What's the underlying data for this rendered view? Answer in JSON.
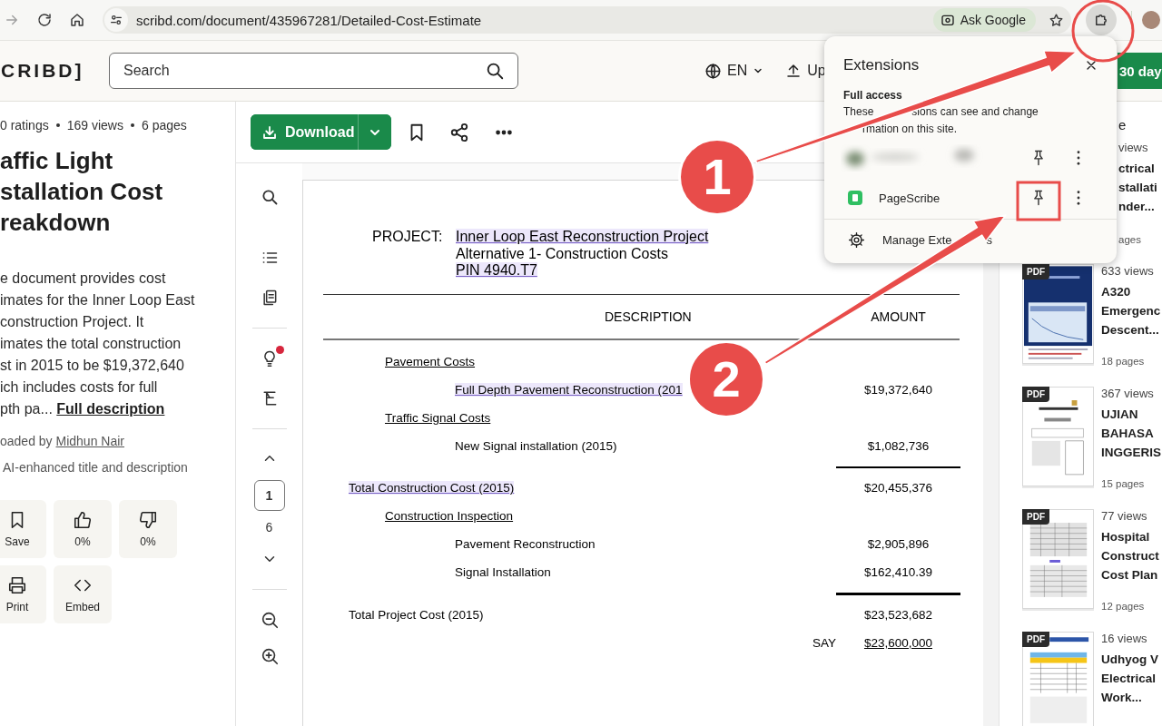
{
  "browser": {
    "url": "scribd.com/document/435967281/Detailed-Cost-Estimate",
    "ask_button": "Ask Google"
  },
  "header": {
    "logo": "CRIBD]",
    "search": {
      "placeholder": "Search"
    },
    "language": "EN",
    "upload": "Up",
    "trial_button": "30 day"
  },
  "document_info": {
    "meta": [
      "0 ratings",
      "169 views",
      "6 pages"
    ],
    "title_lines": [
      "affic Light",
      "stallation Cost",
      "reakdown"
    ],
    "description_lines": [
      "e document provides cost",
      "imates for the Inner Loop East",
      "construction Project. It",
      "imates the total construction",
      "st in 2015 to be $19,372,640",
      "ich includes costs for full"
    ],
    "description_tail": "pth pa... ",
    "full_description_link": "Full description",
    "uploader_prefix": "oaded by ",
    "uploader": "Midhun Nair",
    "ai_note": "AI-enhanced title and description",
    "actions": [
      {
        "kind": "save",
        "label": "Save"
      },
      {
        "kind": "like",
        "label": "0%"
      },
      {
        "kind": "dislike",
        "label": "0%"
      },
      {
        "kind": "print",
        "label": "Print"
      },
      {
        "kind": "embed",
        "label": "Embed"
      }
    ]
  },
  "toolbar": {
    "download": "Download"
  },
  "rail": {
    "insights_notification": true,
    "page": "1",
    "page_count": "6"
  },
  "document": {
    "project_label": "PROJECT:",
    "project_lines": [
      {
        "text": "Inner Loop East Reconstruction Project",
        "highlighted": true
      },
      {
        "text": "Alternative 1- Construction Costs",
        "highlighted": false
      },
      {
        "text": "PIN 4940.T7",
        "highlighted": true
      }
    ],
    "columns": [
      "DESCRIPTION",
      "AMOUNT"
    ],
    "rows": [
      {
        "kind": "section",
        "label": "Pavement Costs",
        "highlighted": false
      },
      {
        "kind": "item",
        "label": "Full Depth Pavement Reconstruction (201",
        "amount": "$19,372,640",
        "highlighted": true
      },
      {
        "kind": "section",
        "label": "Traffic Signal Costs",
        "highlighted": false
      },
      {
        "kind": "item",
        "label": "New Signal installation (2015)",
        "amount": "$1,082,736",
        "highlighted": false
      },
      {
        "kind": "rule"
      },
      {
        "kind": "total",
        "label": "Total Construction Cost (2015)",
        "amount": "$20,455,376",
        "highlighted": true
      },
      {
        "kind": "section",
        "label": "Construction Inspection",
        "highlighted": false
      },
      {
        "kind": "item",
        "label": "Pavement Reconstruction",
        "amount": "$2,905,896",
        "highlighted": false
      },
      {
        "kind": "item",
        "label": "Signal Installation",
        "amount": "$162,410.39",
        "highlighted": false
      },
      {
        "kind": "heavy_rule"
      },
      {
        "kind": "total",
        "label": "Total Project Cost (2015)",
        "amount": "$23,523,682",
        "highlighted": false
      },
      {
        "kind": "say",
        "label": "SAY",
        "amount": "$23,600,000"
      }
    ]
  },
  "related": {
    "heading": "e",
    "partial": {
      "views": "views",
      "title_lines": [
        "ctrical",
        "stallati",
        "nder..."
      ],
      "pages": "ages"
    },
    "items": [
      {
        "badge": "PDF",
        "views": "633 views",
        "title_lines": [
          "A320",
          "Emergenc",
          "Descent..."
        ],
        "pages": "18 pages"
      },
      {
        "badge": "PDF",
        "views": "367 views",
        "title_lines": [
          "UJIAN",
          "BAHASA",
          "INGGERIS"
        ],
        "pages": "15 pages"
      },
      {
        "badge": "PDF",
        "views": "77 views",
        "title_lines": [
          "Hospital",
          "Construct",
          "Cost Plan"
        ],
        "pages": "12 pages"
      },
      {
        "badge": "PDF",
        "views": "16 views",
        "title_lines": [
          "Udhyog V",
          "Electrical",
          "Work..."
        ]
      }
    ]
  },
  "extensions_popup": {
    "title": "Extensions",
    "section": "Full access",
    "description_pieces": [
      "These",
      "sions can see and change",
      "rmation on this site."
    ],
    "extensions": [
      {
        "kind": "blurred"
      },
      {
        "kind": "named",
        "name": "PageScribe"
      }
    ],
    "manage": [
      "Manage Exte",
      "s"
    ]
  },
  "annotations": [
    {
      "kind": "ring"
    },
    {
      "kind": "box"
    },
    {
      "kind": "arrow"
    },
    {
      "kind": "arrow"
    },
    {
      "kind": "callout",
      "label": "1"
    },
    {
      "kind": "callout",
      "label": "2"
    }
  ]
}
